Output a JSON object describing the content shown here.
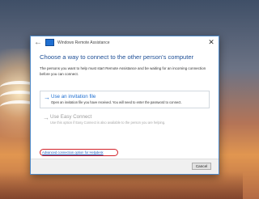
{
  "window": {
    "title": "Windows Remote Assistance",
    "back_glyph": "←",
    "close_glyph": "✕",
    "accent": "#1f6fd1"
  },
  "main": {
    "heading": "Choose a way to connect to the other person's computer",
    "description": "The persons you want to help must start Remote Assistance and be waiting for an incoming connection before you can connect."
  },
  "options": [
    {
      "icon": "arrow-right-icon",
      "arrow": "→",
      "title": "Use an invitation file",
      "description": "Open an invitation file you have received. You will need to enter the password to connect.",
      "enabled": true
    },
    {
      "icon": "arrow-right-icon",
      "arrow": "→",
      "title": "Use Easy Connect",
      "description": "Use this option if Easy Connect is also available to the person you are helping.",
      "enabled": false
    }
  ],
  "link": {
    "text": "Advanced connection option for Helpdesk",
    "highlight_color": "#d2232a"
  },
  "footer": {
    "cancel_label": "Cancel"
  }
}
